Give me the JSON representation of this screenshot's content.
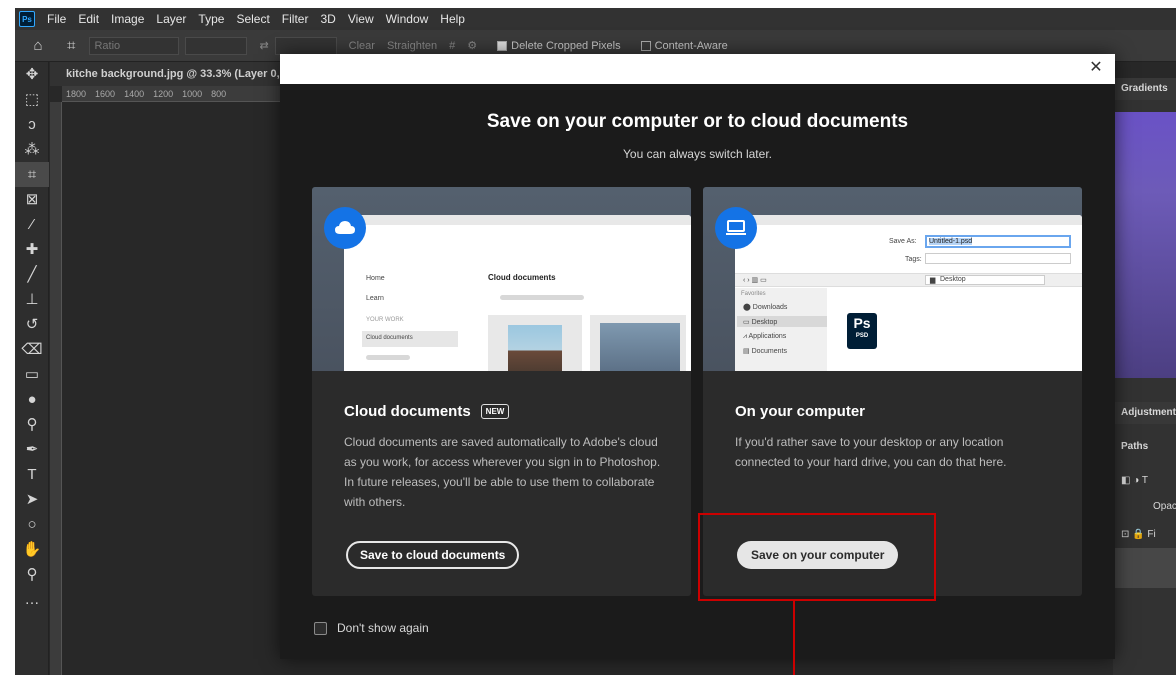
{
  "menubar": {
    "logo": "Ps",
    "items": [
      "File",
      "Edit",
      "Image",
      "Layer",
      "Type",
      "Select",
      "Filter",
      "3D",
      "View",
      "Window",
      "Help"
    ]
  },
  "options": {
    "ratio": "Ratio",
    "clear": "Clear",
    "straighten": "Straighten",
    "delete_cropped": "Delete Cropped Pixels",
    "content_aware": "Content-Aware"
  },
  "document": {
    "tab_title": "kitche background.jpg @ 33.3% (Layer 0,",
    "ruler_ticks": [
      "1800",
      "1600",
      "1400",
      "1200",
      "1000",
      "800"
    ]
  },
  "panels": {
    "gradients": "Gradients",
    "adjustments": "Adjustments",
    "paths": "Paths",
    "opacity": "Opacit",
    "fill": "Fi"
  },
  "dialog": {
    "title": "Save on your computer or to cloud documents",
    "subtitle": "You can always switch later.",
    "cloud_card": {
      "heading": "Cloud documents",
      "badge": "NEW",
      "body": "Cloud documents are saved automatically to Adobe's cloud as you work, for access wherever you sign in to Photoshop. In future releases, you'll be able to use them to collaborate with others.",
      "button": "Save to cloud documents",
      "illus": {
        "home": "Home",
        "learn": "Learn",
        "your_work": "YOUR WORK",
        "cloud_docs": "Cloud documents",
        "heading": "Cloud documents"
      }
    },
    "computer_card": {
      "heading": "On your computer",
      "body": "If you'd rather save to your desktop or any location connected to your hard drive, you can do that here.",
      "button": "Save on your computer",
      "illus": {
        "save_as_label": "Save As:",
        "save_as_value": "Untitled-1.psd",
        "tags_label": "Tags:",
        "location": "Desktop",
        "favorites": "Favorites",
        "downloads": "Downloads",
        "desktop": "Desktop",
        "applications": "Applications",
        "documents": "Documents",
        "ps_label": "Ps",
        "psd_label": "PSD"
      }
    },
    "dont_show": "Don't show again"
  },
  "colors": {
    "accent": "#1473e6",
    "annotation": "#cc0000",
    "dialog_bg": "#1b1b1b",
    "card_bg": "#2b2b2b"
  }
}
